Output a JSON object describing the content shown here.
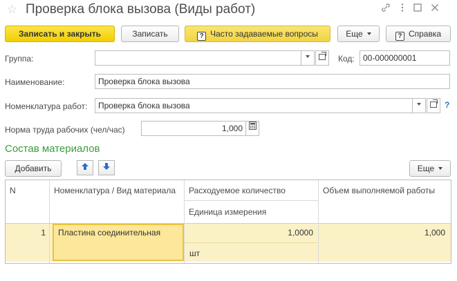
{
  "window": {
    "title": "Проверка блока вызова (Виды работ)",
    "icons": [
      "star-icon",
      "link-icon",
      "more-icon",
      "maximize-icon",
      "close-icon"
    ]
  },
  "toolbar": {
    "save_close_label": "Записать и закрыть",
    "save_label": "Записать",
    "faq_label": "Часто задаваемые вопросы",
    "faq_icon_glyph": "?",
    "more_label": "Еще",
    "help_icon_glyph": "?",
    "help_label": "Справка"
  },
  "form": {
    "group_label": "Группа:",
    "group_value": "",
    "code_label": "Код:",
    "code_value": "00-000000001",
    "name_label": "Наименование:",
    "name_value": "Проверка блока вызова",
    "nomenclature_label": "Номенклатура работ:",
    "nomenclature_value": "Проверка блока вызова",
    "help_glyph": "?",
    "labor_norm_label": "Норма труда рабочих (чел/час)",
    "labor_norm_value": "1,000"
  },
  "materials": {
    "title": "Состав материалов",
    "add_label": "Добавить",
    "more_label": "Еще",
    "columns": {
      "n": "N",
      "nomenclature": "Номенклатура / Вид материала",
      "quantity": "Расходуемое количество",
      "unit": "Единица измерения",
      "volume": "Объем выполняемой работы"
    },
    "rows": [
      {
        "n": "1",
        "nomenclature": "Пластина соединительная",
        "quantity": "1,0000",
        "unit": "шт",
        "volume": "1,000"
      }
    ]
  },
  "colors": {
    "primary_button": "#f2cf00",
    "section_title": "#3a9e3a",
    "selected_row": "#fbf1c7",
    "active_cell": "#fde79a",
    "help_link": "#2c6fc8"
  }
}
